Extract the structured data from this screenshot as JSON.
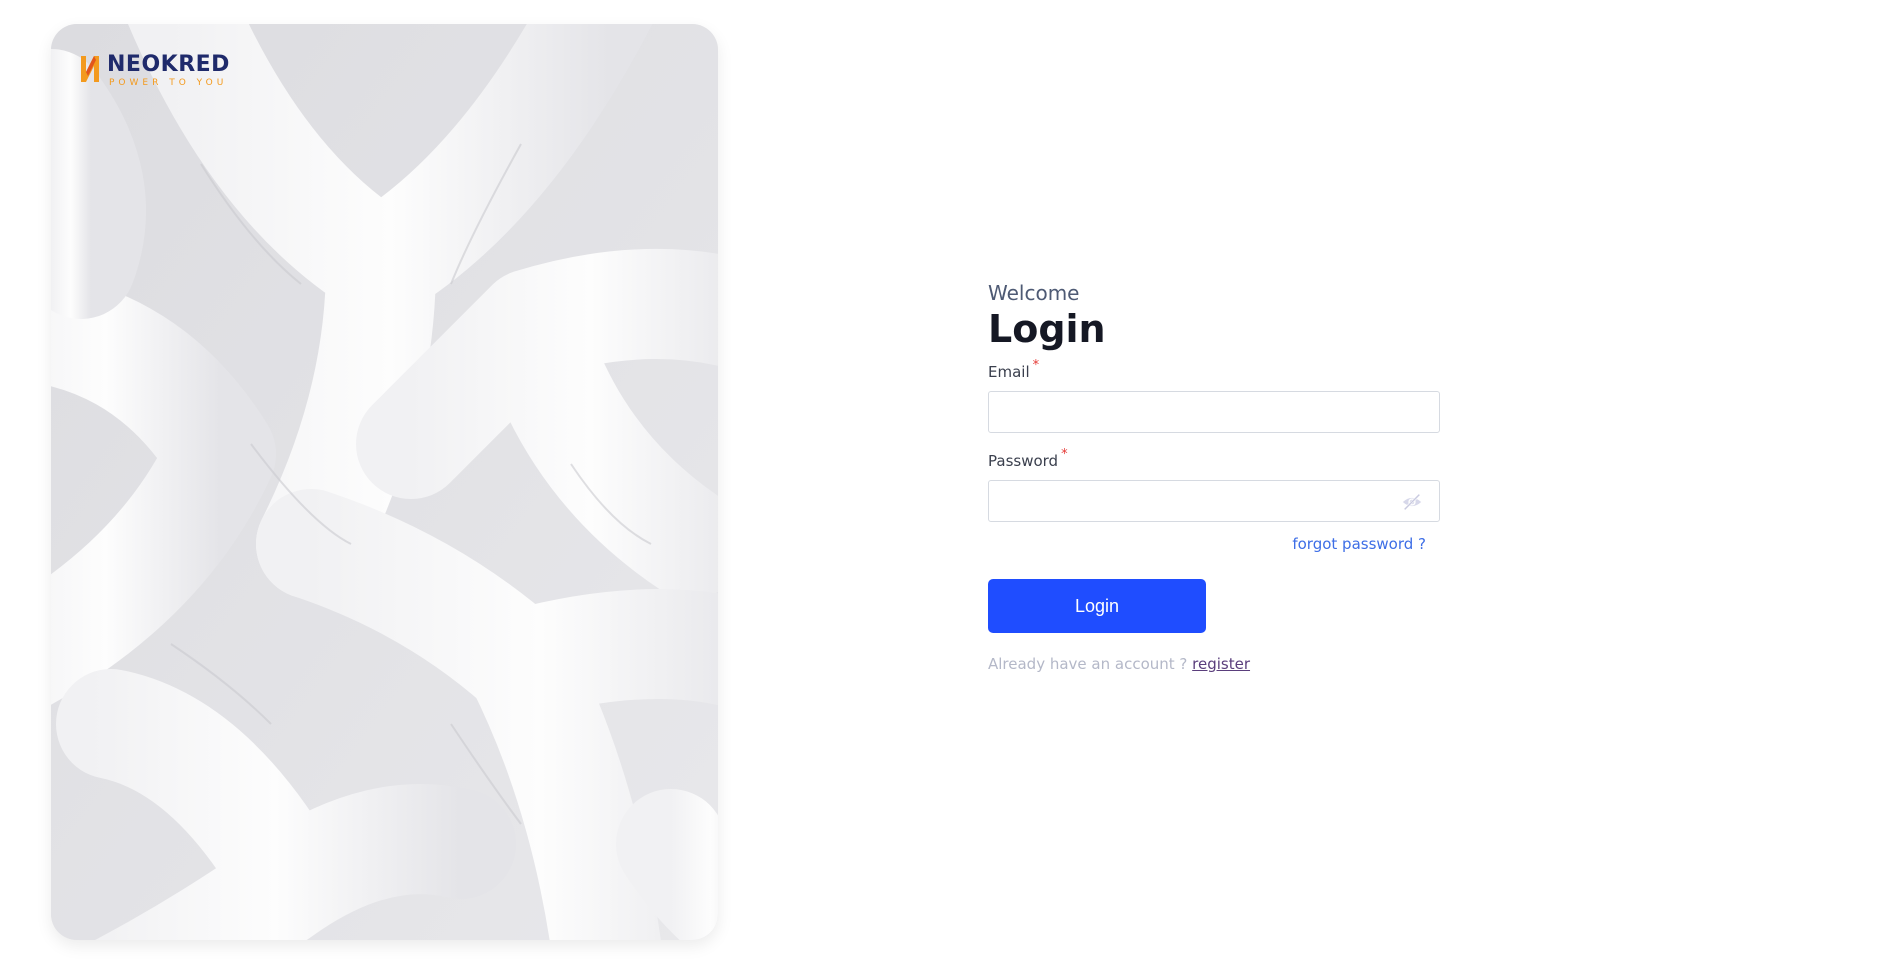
{
  "brand": {
    "name": "NEOKRED",
    "tagline": "POWER TO YOU",
    "colors": {
      "primary": "#1f2a6b",
      "accent": "#f39a1e"
    }
  },
  "form": {
    "welcome": "Welcome",
    "title": "Login",
    "email": {
      "label": "Email",
      "required_mark": "*",
      "value": "",
      "placeholder": ""
    },
    "password": {
      "label": "Password",
      "required_mark": "*",
      "value": "",
      "placeholder": "",
      "toggle_icon": "eye-off-icon"
    },
    "forgot_password": "forgot password ?",
    "submit_label": "Login",
    "register_prompt": "Already have an account ?",
    "register_link": "register"
  },
  "colors": {
    "button": "#1f4dff",
    "link": "#3d6ee6",
    "required": "#e53935"
  }
}
